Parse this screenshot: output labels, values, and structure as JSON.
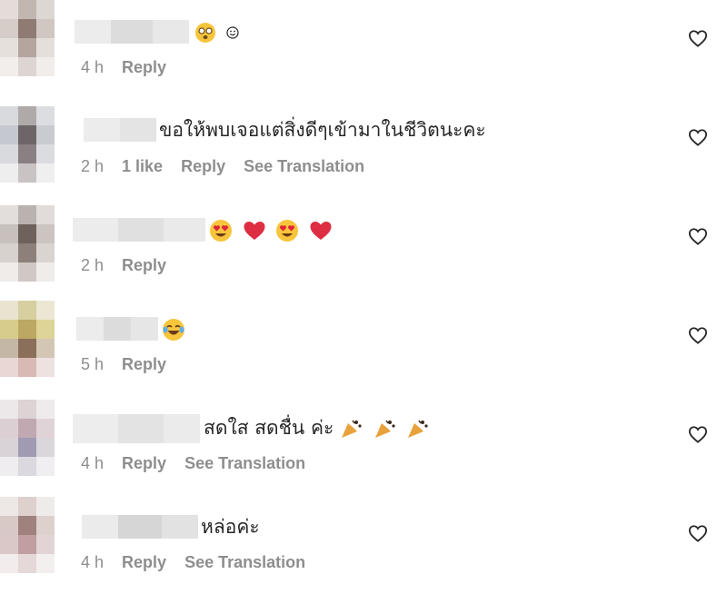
{
  "comments": [
    {
      "text": "",
      "emoji": [
        "dizzy-face-emoji",
        "smiley-emoji"
      ],
      "time": "4 h",
      "likes": "",
      "reply": "Reply",
      "translate": ""
    },
    {
      "text": "ขอให้พบเจอแต่สิ่งดีๆเข้ามาในชีวิตนะคะ",
      "emoji": [],
      "time": "2 h",
      "likes": "1 like",
      "reply": "Reply",
      "translate": "See Translation"
    },
    {
      "text": "",
      "emoji": [
        "heart-eyes-emoji",
        "red-heart-emoji",
        "heart-eyes-emoji",
        "red-heart-emoji"
      ],
      "time": "2 h",
      "likes": "",
      "reply": "Reply",
      "translate": ""
    },
    {
      "text": "",
      "emoji": [
        "tears-of-joy-emoji"
      ],
      "time": "5 h",
      "likes": "",
      "reply": "Reply",
      "translate": ""
    },
    {
      "text": "สดใส สดชื่น ค่ะ",
      "emoji": [
        "party-popper-emoji",
        "party-popper-emoji",
        "party-popper-emoji"
      ],
      "time": "4 h",
      "likes": "",
      "reply": "Reply",
      "translate": "See Translation"
    },
    {
      "text": "หล่อค่ะ",
      "emoji": [],
      "time": "4 h",
      "likes": "",
      "reply": "Reply",
      "translate": "See Translation"
    }
  ],
  "colors": {
    "meta": "#8e8e8e",
    "text": "#262626",
    "heart_stroke": "#262626"
  },
  "icons": {
    "like": "heart-outline-icon"
  }
}
